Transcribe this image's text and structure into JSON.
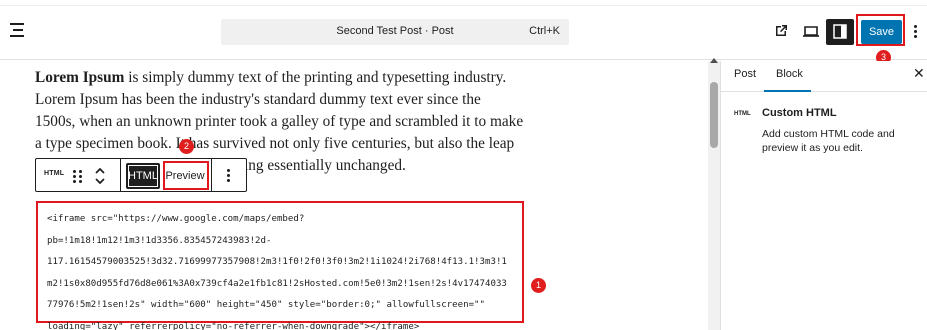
{
  "header": {
    "document_title": "Second Test Post · Post",
    "shortcut": "Ctrl+K",
    "save_label": "Save"
  },
  "editor": {
    "paragraph": {
      "lead_bold": "Lorem Ipsum",
      "line1_rest": " is simply dummy text of the printing and typesetting industry.",
      "line2": "Lorem Ipsum has been the industry's standard dummy text ever since the",
      "line3": "1500s, when an unknown printer took a galley of type and scrambled it to make",
      "line4": "a type specimen book. It has survived not only five centuries, but also the leap",
      "line5": "into electronic typesetting, remaining essentially unchanged."
    },
    "block_toolbar": {
      "block_type_icon": "HTML",
      "html_tab": "HTML",
      "preview_tab": "Preview"
    },
    "code_lines": [
      "<iframe src=\"https://www.google.com/maps/embed?",
      "pb=!1m18!1m12!1m3!1d3356.835457243983!2d-",
      "117.16154579003525!3d32.71699977357908!2m3!1f0!2f0!3f0!3m2!1i1024!2i768!4f13.1!3m3!1",
      "m2!1s0x80d955fd76d8e061%3A0x739cf4a2e1fb1c81!2sHosted.com!5e0!3m2!1sen!2s!4v17474033",
      "77976!5m2!1sen!2s\" width=\"600\" height=\"450\" style=\"border:0;\" allowfullscreen=\"\"",
      "loading=\"lazy\" referrerpolicy=\"no-referrer-when-downgrade\"></iframe>"
    ]
  },
  "sidebar": {
    "tabs": [
      {
        "label": "Post"
      },
      {
        "label": "Block"
      }
    ],
    "close_glyph": "✕",
    "block_icon_text": "HTML",
    "block_title": "Custom HTML",
    "block_description": "Add custom HTML code and preview it as you edit."
  },
  "annotations": {
    "code_box_badge": "1",
    "preview_badge": "2",
    "save_badge": "3",
    "highlight_color": "#e0181d"
  },
  "colors": {
    "accent": "#0073b1",
    "dark": "#1e1e1e"
  },
  "icons": [
    "document-overview-icon",
    "view-post-icon",
    "device-preview-icon",
    "settings-sidebar-icon",
    "more-options-icon",
    "drag-handle-icon",
    "move-up-down-icon",
    "close-icon"
  ]
}
